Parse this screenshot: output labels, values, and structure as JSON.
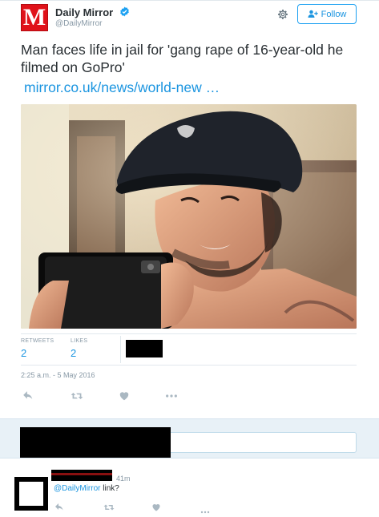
{
  "account": {
    "logo_letter": "M",
    "name": "Daily Mirror",
    "handle": "@DailyMirror",
    "verified": true,
    "brand_color": "#e0121a"
  },
  "header": {
    "settings_icon": "gear-icon",
    "follow_label": "Follow",
    "follow_icon": "add-user-icon",
    "accent_color": "#1da1f2"
  },
  "tweet": {
    "text": "Man faces life in jail for 'gang rape of 16-year-old he filmed on GoPro'",
    "link": "mirror.co.uk/news/world-new …",
    "photo": "selfie-photo",
    "timestamp": "2:25 a.m. - 5 May 2016"
  },
  "stats": {
    "retweets_label": "RETWEETS",
    "retweets_value": "2",
    "likes_label": "LIKES",
    "likes_value": "2"
  },
  "actions": [
    "reply-icon",
    "retweet-icon",
    "like-icon",
    "more-icon"
  ],
  "reply_box": {
    "placeholder": ""
  },
  "comment": {
    "time": "41m",
    "mention": "@DailyMirror",
    "text": " link?"
  }
}
